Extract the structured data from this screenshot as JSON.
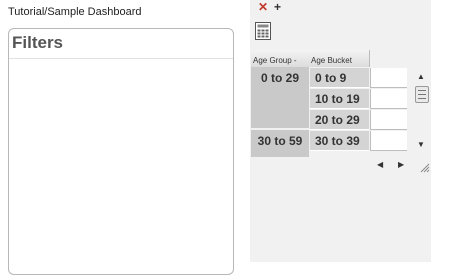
{
  "breadcrumb": "Tutorial/Sample Dashboard",
  "filters": {
    "title": "Filters"
  },
  "toolbar": {
    "close_glyph": "✕",
    "add_glyph": "+"
  },
  "pivot": {
    "headers": {
      "age_group": "Age Group",
      "age_bucket": "Age Bucket"
    },
    "groups": [
      {
        "label": "0 to 29",
        "buckets": [
          "0 to 9",
          "10 to 19",
          "20 to 29"
        ]
      },
      {
        "label": "30 to 59",
        "buckets": [
          "30 to 39"
        ]
      }
    ]
  },
  "colors": {
    "close": "#c0392b",
    "panel_bg": "#f1f1f1",
    "group_bg": "#c9c9c9",
    "bucket_bg": "#d4d4d4"
  },
  "icons": [
    "close-icon",
    "add-icon",
    "calculator-icon",
    "scroll-up-icon",
    "scroll-down-icon",
    "scroll-left-icon",
    "scroll-right-icon",
    "resize-grip-icon"
  ]
}
